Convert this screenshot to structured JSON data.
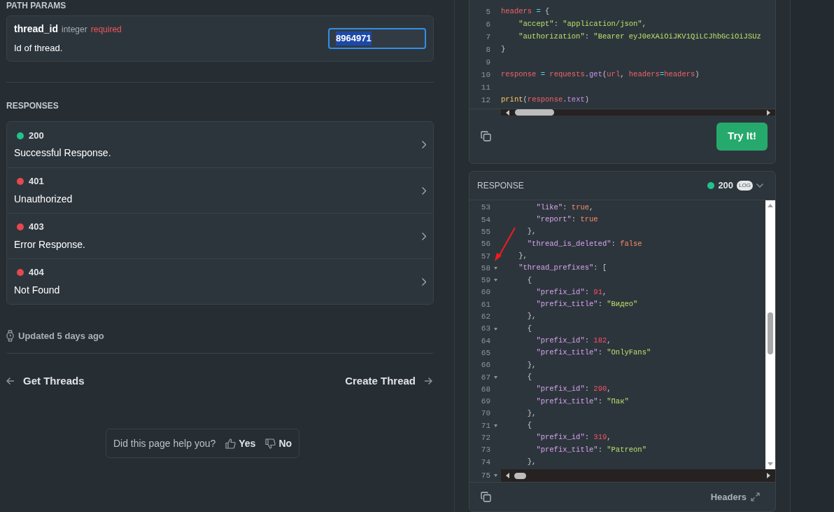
{
  "path_params": {
    "heading": "PATH PARAMS",
    "param": {
      "name": "thread_id",
      "type": "integer",
      "required_label": "required",
      "description": "Id of thread.",
      "value": "8964971"
    }
  },
  "responses": {
    "heading": "RESPONSES",
    "items": [
      {
        "code": "200",
        "label": "Successful Response.",
        "color": "#1fc48d"
      },
      {
        "code": "401",
        "label": "Unauthorized",
        "color": "#e5484d"
      },
      {
        "code": "403",
        "label": "Error Response.",
        "color": "#e5484d"
      },
      {
        "code": "404",
        "label": "Not Found",
        "color": "#e5484d"
      }
    ]
  },
  "updated": "Updated 5 days ago",
  "nav": {
    "previous": "Get Threads",
    "next": "Create Thread"
  },
  "feedback": {
    "question": "Did this page help you?",
    "yes": "Yes",
    "no": "No"
  },
  "request_code": {
    "lines": [
      {
        "num": "5",
        "tokens": [
          {
            "kind": "var",
            "text": "headers"
          },
          {
            "kind": "op",
            "text": " = "
          },
          {
            "kind": "punct",
            "text": "{"
          }
        ]
      },
      {
        "num": "6",
        "tokens": [
          {
            "kind": "str",
            "text": "    \"accept\""
          },
          {
            "kind": "punct",
            "text": ": "
          },
          {
            "kind": "str",
            "text": "\"application/json\""
          },
          {
            "kind": "punct",
            "text": ","
          }
        ]
      },
      {
        "num": "7",
        "tokens": [
          {
            "kind": "str",
            "text": "    \"authorization\""
          },
          {
            "kind": "punct",
            "text": ": "
          },
          {
            "kind": "str",
            "text": "\"Bearer eyJ0eXAiOiJKV1QiLCJhbGciOiJSUz"
          }
        ]
      },
      {
        "num": "8",
        "tokens": [
          {
            "kind": "punct",
            "text": "}"
          }
        ]
      },
      {
        "num": "9"
      },
      {
        "num": "10",
        "tokens": [
          {
            "kind": "var",
            "text": "response"
          },
          {
            "kind": "op",
            "text": " = "
          },
          {
            "kind": "var",
            "text": "requests"
          },
          {
            "kind": "punct",
            "text": "."
          },
          {
            "kind": "fn",
            "text": "get"
          },
          {
            "kind": "punct",
            "text": "("
          },
          {
            "kind": "var",
            "text": "url"
          },
          {
            "kind": "punct",
            "text": ", "
          },
          {
            "kind": "var",
            "text": "headers"
          },
          {
            "kind": "op",
            "text": "="
          },
          {
            "kind": "var",
            "text": "headers"
          },
          {
            "kind": "punct",
            "text": ")"
          }
        ]
      },
      {
        "num": "11"
      },
      {
        "num": "12",
        "tokens": [
          {
            "kind": "builtin",
            "text": "print"
          },
          {
            "kind": "punct",
            "text": "("
          },
          {
            "kind": "var",
            "text": "response"
          },
          {
            "kind": "punct",
            "text": "."
          },
          {
            "kind": "fn",
            "text": "text"
          },
          {
            "kind": "punct",
            "text": ")"
          }
        ]
      }
    ],
    "try_button": "Try It!"
  },
  "response_panel": {
    "heading": "RESPONSE",
    "status": "200",
    "status_ok": true,
    "log_badge": "LOG",
    "footer_link": "Headers",
    "lines": [
      {
        "num": "53",
        "fold": false,
        "tokens": [
          {
            "kind": "key",
            "text": "        \"like\""
          },
          {
            "kind": "punct",
            "text": ": "
          },
          {
            "kind": "bool",
            "text": "true"
          },
          {
            "kind": "punct",
            "text": ","
          }
        ]
      },
      {
        "num": "54",
        "fold": false,
        "tokens": [
          {
            "kind": "key",
            "text": "        \"report\""
          },
          {
            "kind": "punct",
            "text": ": "
          },
          {
            "kind": "bool",
            "text": "true"
          }
        ]
      },
      {
        "num": "55",
        "fold": false,
        "tokens": [
          {
            "kind": "punct",
            "text": "      },"
          }
        ]
      },
      {
        "num": "56",
        "fold": false,
        "tokens": [
          {
            "kind": "key",
            "text": "      \"thread_is_deleted\""
          },
          {
            "kind": "punct",
            "text": ": "
          },
          {
            "kind": "bool",
            "text": "false"
          }
        ]
      },
      {
        "num": "57",
        "fold": false,
        "tokens": [
          {
            "kind": "punct",
            "text": "    },"
          }
        ]
      },
      {
        "num": "58",
        "fold": true,
        "tokens": [
          {
            "kind": "key",
            "text": "    \"thread_prefixes\""
          },
          {
            "kind": "punct",
            "text": ": ["
          }
        ]
      },
      {
        "num": "59",
        "fold": true,
        "tokens": [
          {
            "kind": "punct",
            "text": "      {"
          }
        ]
      },
      {
        "num": "60",
        "fold": false,
        "tokens": [
          {
            "kind": "key",
            "text": "        \"prefix_id\""
          },
          {
            "kind": "punct",
            "text": ": "
          },
          {
            "kind": "num",
            "text": "91"
          },
          {
            "kind": "punct",
            "text": ","
          }
        ]
      },
      {
        "num": "61",
        "fold": false,
        "tokens": [
          {
            "kind": "key",
            "text": "        \"prefix_title\""
          },
          {
            "kind": "punct",
            "text": ": "
          },
          {
            "kind": "str",
            "text": "\"Видео\""
          }
        ]
      },
      {
        "num": "62",
        "fold": false,
        "tokens": [
          {
            "kind": "punct",
            "text": "      },"
          }
        ]
      },
      {
        "num": "63",
        "fold": true,
        "tokens": [
          {
            "kind": "punct",
            "text": "      {"
          }
        ]
      },
      {
        "num": "64",
        "fold": false,
        "tokens": [
          {
            "kind": "key",
            "text": "        \"prefix_id\""
          },
          {
            "kind": "punct",
            "text": ": "
          },
          {
            "kind": "num",
            "text": "182"
          },
          {
            "kind": "punct",
            "text": ","
          }
        ]
      },
      {
        "num": "65",
        "fold": false,
        "tokens": [
          {
            "kind": "key",
            "text": "        \"prefix_title\""
          },
          {
            "kind": "punct",
            "text": ": "
          },
          {
            "kind": "str",
            "text": "\"OnlyFans\""
          }
        ]
      },
      {
        "num": "66",
        "fold": false,
        "tokens": [
          {
            "kind": "punct",
            "text": "      },"
          }
        ]
      },
      {
        "num": "67",
        "fold": true,
        "tokens": [
          {
            "kind": "punct",
            "text": "      {"
          }
        ]
      },
      {
        "num": "68",
        "fold": false,
        "tokens": [
          {
            "kind": "key",
            "text": "        \"prefix_id\""
          },
          {
            "kind": "punct",
            "text": ": "
          },
          {
            "kind": "num",
            "text": "290"
          },
          {
            "kind": "punct",
            "text": ","
          }
        ]
      },
      {
        "num": "69",
        "fold": false,
        "tokens": [
          {
            "kind": "key",
            "text": "        \"prefix_title\""
          },
          {
            "kind": "punct",
            "text": ": "
          },
          {
            "kind": "str",
            "text": "\"Пак\""
          }
        ]
      },
      {
        "num": "70",
        "fold": false,
        "tokens": [
          {
            "kind": "punct",
            "text": "      },"
          }
        ]
      },
      {
        "num": "71",
        "fold": true,
        "tokens": [
          {
            "kind": "punct",
            "text": "      {"
          }
        ]
      },
      {
        "num": "72",
        "fold": false,
        "tokens": [
          {
            "kind": "key",
            "text": "        \"prefix_id\""
          },
          {
            "kind": "punct",
            "text": ": "
          },
          {
            "kind": "num",
            "text": "319"
          },
          {
            "kind": "punct",
            "text": ","
          }
        ]
      },
      {
        "num": "73",
        "fold": false,
        "tokens": [
          {
            "kind": "key",
            "text": "        \"prefix_title\""
          },
          {
            "kind": "punct",
            "text": ": "
          },
          {
            "kind": "str",
            "text": "\"Patreon\""
          }
        ]
      },
      {
        "num": "74",
        "fold": false,
        "tokens": [
          {
            "kind": "punct",
            "text": "      },"
          }
        ]
      },
      {
        "num": "75",
        "fold": true
      }
    ]
  }
}
